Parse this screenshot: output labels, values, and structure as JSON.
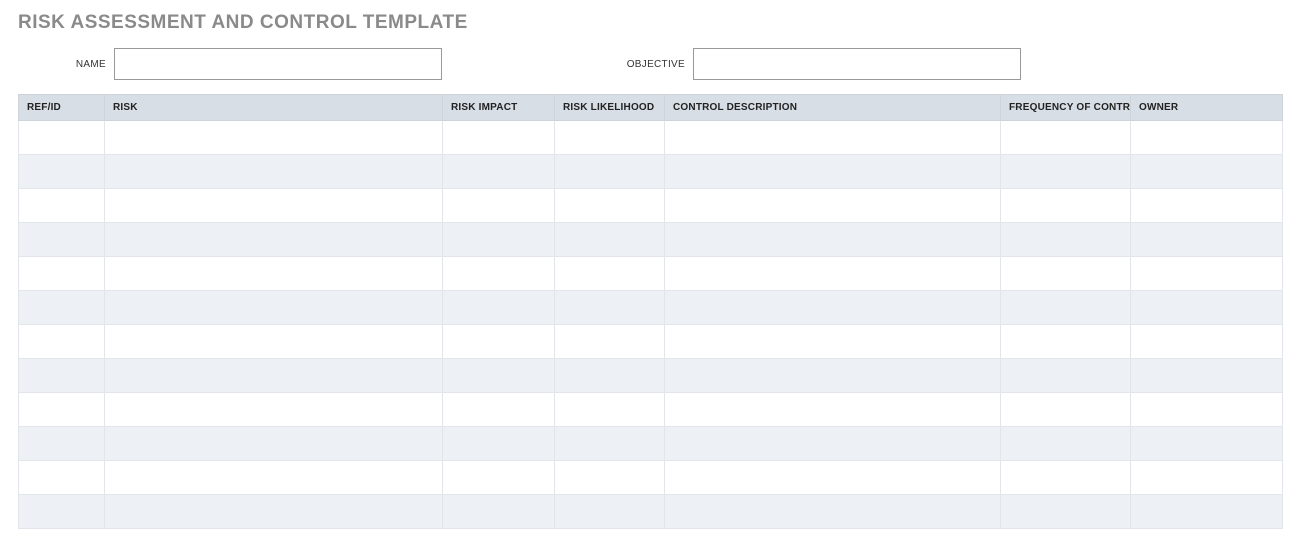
{
  "title": "RISK ASSESSMENT AND CONTROL TEMPLATE",
  "meta": {
    "name_label": "NAME",
    "name_value": "",
    "objective_label": "OBJECTIVE",
    "objective_value": ""
  },
  "columns": {
    "ref": "REF/ID",
    "risk": "RISK",
    "impact": "RISK IMPACT",
    "likelihood": "RISK LIKELIHOOD",
    "controldesc": "CONTROL DESCRIPTION",
    "frequency": "FREQUENCY OF CONTROL",
    "owner": "OWNER"
  },
  "rows": [
    {
      "ref": "",
      "risk": "",
      "impact": "",
      "likelihood": "",
      "controldesc": "",
      "frequency": "",
      "owner": ""
    },
    {
      "ref": "",
      "risk": "",
      "impact": "",
      "likelihood": "",
      "controldesc": "",
      "frequency": "",
      "owner": ""
    },
    {
      "ref": "",
      "risk": "",
      "impact": "",
      "likelihood": "",
      "controldesc": "",
      "frequency": "",
      "owner": ""
    },
    {
      "ref": "",
      "risk": "",
      "impact": "",
      "likelihood": "",
      "controldesc": "",
      "frequency": "",
      "owner": ""
    },
    {
      "ref": "",
      "risk": "",
      "impact": "",
      "likelihood": "",
      "controldesc": "",
      "frequency": "",
      "owner": ""
    },
    {
      "ref": "",
      "risk": "",
      "impact": "",
      "likelihood": "",
      "controldesc": "",
      "frequency": "",
      "owner": ""
    },
    {
      "ref": "",
      "risk": "",
      "impact": "",
      "likelihood": "",
      "controldesc": "",
      "frequency": "",
      "owner": ""
    },
    {
      "ref": "",
      "risk": "",
      "impact": "",
      "likelihood": "",
      "controldesc": "",
      "frequency": "",
      "owner": ""
    },
    {
      "ref": "",
      "risk": "",
      "impact": "",
      "likelihood": "",
      "controldesc": "",
      "frequency": "",
      "owner": ""
    },
    {
      "ref": "",
      "risk": "",
      "impact": "",
      "likelihood": "",
      "controldesc": "",
      "frequency": "",
      "owner": ""
    },
    {
      "ref": "",
      "risk": "",
      "impact": "",
      "likelihood": "",
      "controldesc": "",
      "frequency": "",
      "owner": ""
    },
    {
      "ref": "",
      "risk": "",
      "impact": "",
      "likelihood": "",
      "controldesc": "",
      "frequency": "",
      "owner": ""
    }
  ]
}
